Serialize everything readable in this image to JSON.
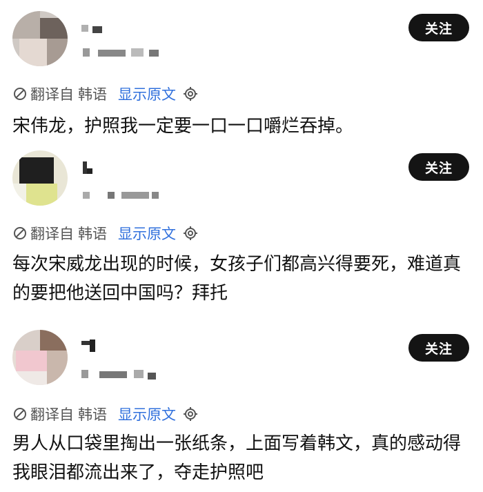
{
  "posts": [
    {
      "follow_label": "关注",
      "translate": {
        "from": "翻译自",
        "lang": "韩语",
        "show_original": "显示原文"
      },
      "text": "宋伟龙，护照我一定要一口一口嚼烂吞掉。"
    },
    {
      "follow_label": "关注",
      "translate": {
        "from": "翻译自",
        "lang": "韩语",
        "show_original": "显示原文"
      },
      "text": "每次宋威龙出现的时候，女孩子们都高兴得要死，难道真的要把他送回中国吗？拜托"
    },
    {
      "follow_label": "关注",
      "translate": {
        "from": "翻译自",
        "lang": "韩语",
        "show_original": "显示原文"
      },
      "text": "男人从口袋里掏出一张纸条，上面写着韩文，真的感动得我眼泪都流出来了，夺走护照吧"
    }
  ],
  "colors": {
    "follow_bg": "#141414",
    "link": "#2f6fdc",
    "meta": "#555555"
  }
}
